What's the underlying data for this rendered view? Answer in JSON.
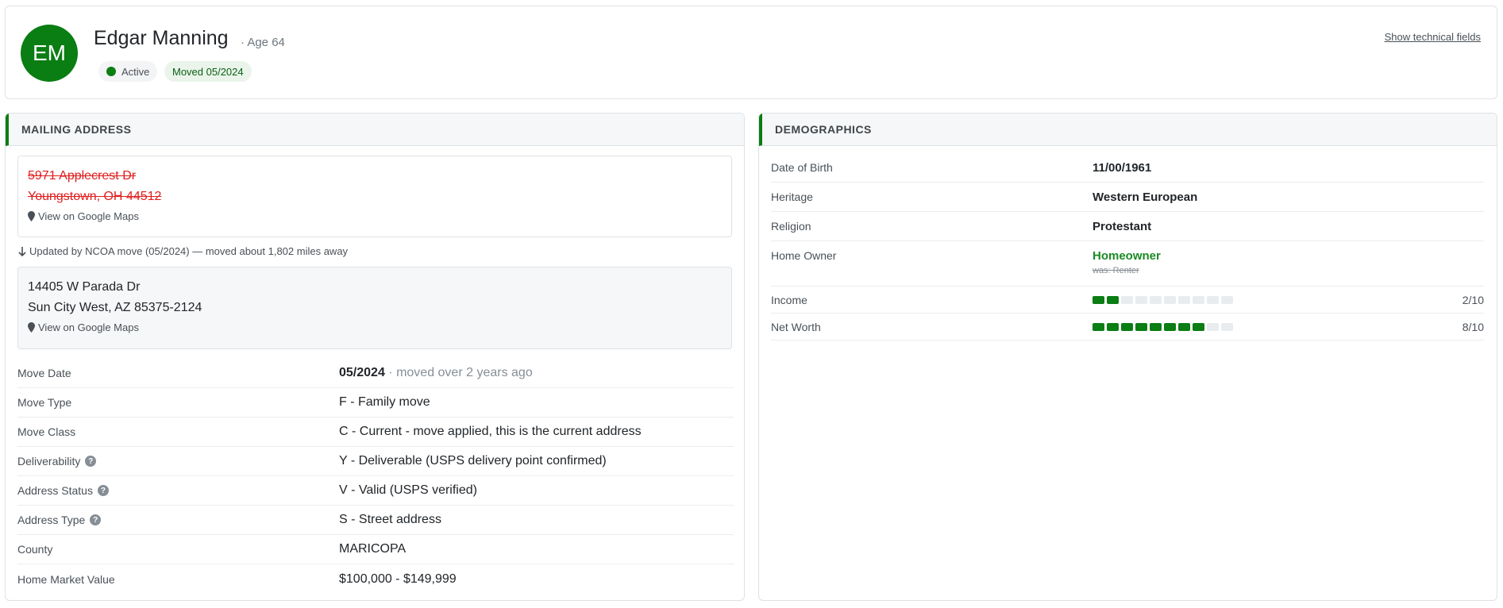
{
  "profile": {
    "initials": "EM",
    "name": "Edgar Manning",
    "age_text": "· Age 64",
    "status_badge": "Active",
    "moved_badge": "Moved 05/2024",
    "tech_link": "Show technical fields"
  },
  "mailing": {
    "title": "MAILING ADDRESS",
    "old_address": {
      "line1": "5971 Applecrest Dr",
      "line2": "Youngstown, OH 44512",
      "map_link": "View on Google Maps"
    },
    "ncoa_note": "Updated by NCOA move (05/2024) — moved about 1,802 miles away",
    "new_address": {
      "line1": "14405 W Parada Dr",
      "line2": "Sun City West, AZ 85375-2124",
      "map_link": "View on Google Maps"
    },
    "fields": [
      {
        "label": "Move Date",
        "value": "05/2024",
        "extra": " · moved over 2 years ago",
        "help": false
      },
      {
        "label": "Move Type",
        "value": "F - Family move",
        "help": false
      },
      {
        "label": "Move Class",
        "value": "C - Current - move applied, this is the current address",
        "help": false
      },
      {
        "label": "Deliverability",
        "value": "Y - Deliverable (USPS delivery point confirmed)",
        "help": true
      },
      {
        "label": "Address Status",
        "value": "V - Valid (USPS verified)",
        "help": true
      },
      {
        "label": "Address Type",
        "value": "S - Street address",
        "help": true
      },
      {
        "label": "County",
        "value": "MARICOPA",
        "help": false
      },
      {
        "label": "Home Market Value",
        "value": "$100,000 - $149,999",
        "help": false
      }
    ]
  },
  "demographics": {
    "title": "DEMOGRAPHICS",
    "fields": [
      {
        "label": "Date of Birth",
        "value": "11/00/1961"
      },
      {
        "label": "Heritage",
        "value": "Western European"
      },
      {
        "label": "Religion",
        "value": "Protestant"
      },
      {
        "label": "Home Owner",
        "value": "Homeowner",
        "was": "was: Renter"
      }
    ],
    "scores": [
      {
        "label": "Income",
        "level": 2,
        "max": 10,
        "text": "2/10"
      },
      {
        "label": "Net Worth",
        "level": 8,
        "max": 10,
        "text": "8/10"
      }
    ]
  },
  "colors": {
    "accent": "#0a7d13",
    "old_address": "#e01e1e",
    "help_icon": "#868e96"
  },
  "icons": {
    "map": "map-pin-icon",
    "ncoa": "arrow-down-icon",
    "help": "question-circle-icon",
    "status": "status-dot-icon"
  }
}
